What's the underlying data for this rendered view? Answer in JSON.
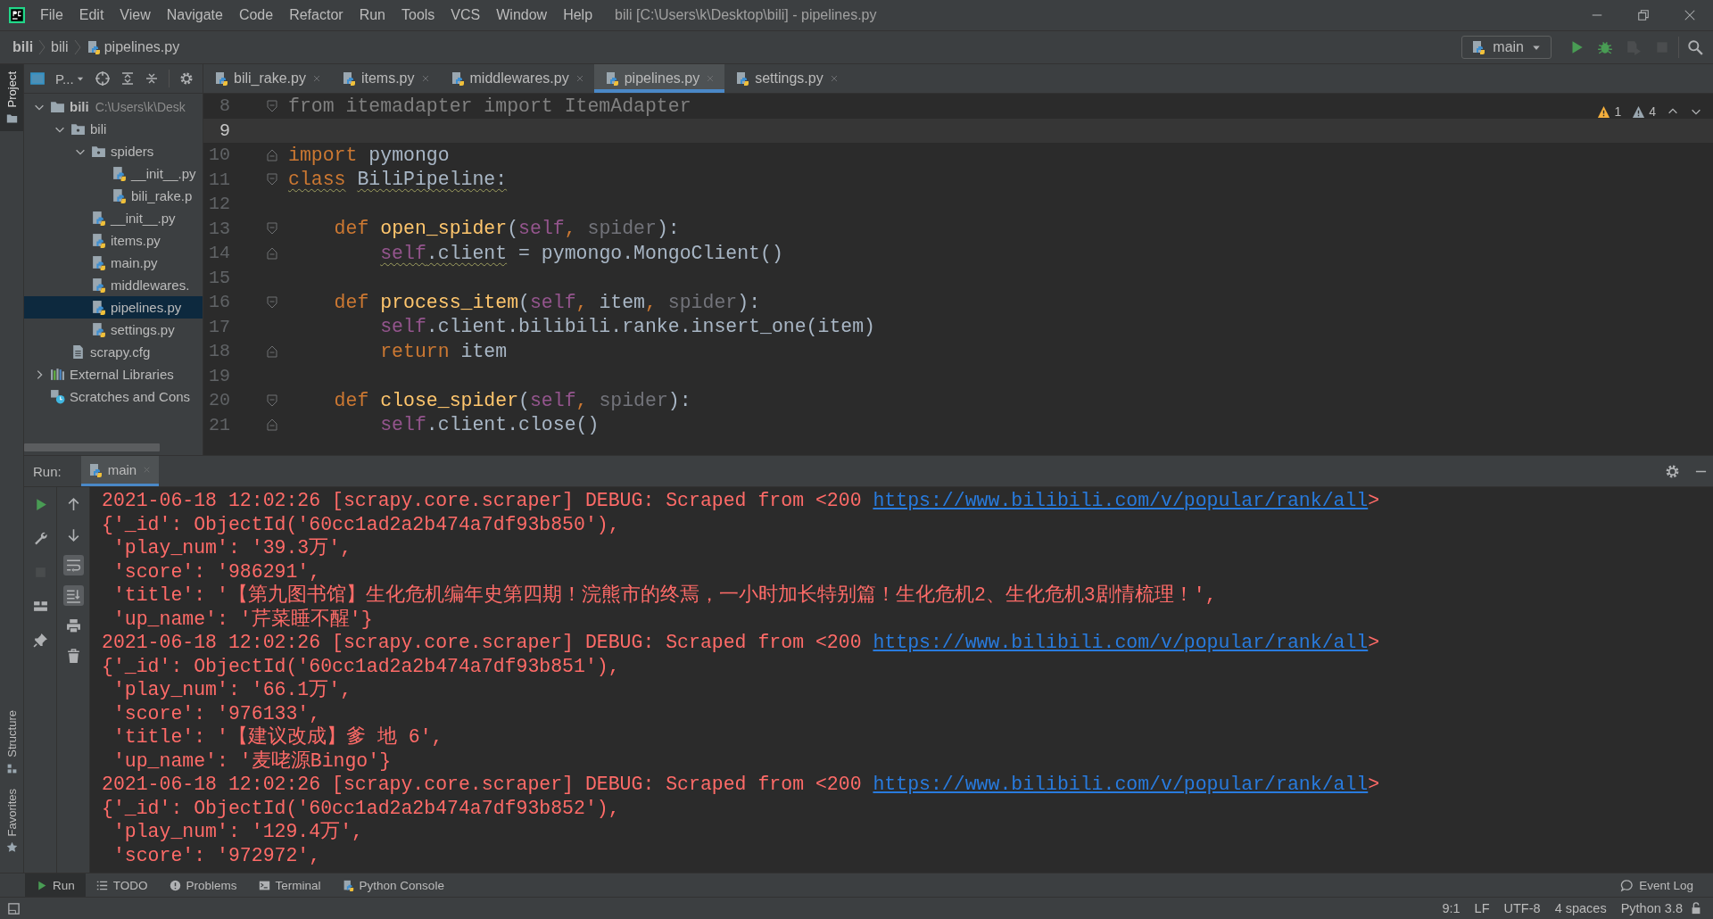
{
  "window": {
    "title": "bili [C:\\Users\\k\\Desktop\\bili] - pipelines.py"
  },
  "menu": [
    "File",
    "Edit",
    "View",
    "Navigate",
    "Code",
    "Refactor",
    "Run",
    "Tools",
    "VCS",
    "Window",
    "Help"
  ],
  "breadcrumbs": [
    "bili",
    "bili",
    "pipelines.py"
  ],
  "run_config": {
    "label": "main"
  },
  "actions": [
    {
      "kind": "run",
      "disabled": false
    },
    {
      "kind": "debug",
      "disabled": false
    },
    {
      "kind": "coverage",
      "disabled": true
    },
    {
      "kind": "stop",
      "disabled": true
    },
    {
      "kind": "search",
      "disabled": false
    }
  ],
  "side_stripe": [
    {
      "label": "Project",
      "kind": "project",
      "selected": true
    },
    {
      "label": "Structure",
      "kind": "structure",
      "selected": false
    },
    {
      "label": "Favorites",
      "kind": "favorites",
      "selected": false
    }
  ],
  "project": {
    "title": "P...",
    "tree": [
      {
        "label": "bili",
        "hint": "C:\\Users\\k\\Desk",
        "kind": "root",
        "expanded": true,
        "selected": false,
        "children": [
          {
            "label": "bili",
            "kind": "package",
            "expanded": true,
            "selected": false,
            "children": [
              {
                "label": "spiders",
                "kind": "package",
                "expanded": true,
                "selected": false,
                "children": [
                  {
                    "label": "__init__.py",
                    "kind": "python",
                    "selected": false
                  },
                  {
                    "label": "bili_rake.p",
                    "kind": "python",
                    "selected": false
                  }
                ]
              },
              {
                "label": "__init__.py",
                "kind": "python",
                "selected": false
              },
              {
                "label": "items.py",
                "kind": "python",
                "selected": false
              },
              {
                "label": "main.py",
                "kind": "python",
                "selected": false
              },
              {
                "label": "middlewares.",
                "kind": "python",
                "selected": false
              },
              {
                "label": "pipelines.py",
                "kind": "python",
                "selected": true
              },
              {
                "label": "settings.py",
                "kind": "python",
                "selected": false
              }
            ]
          },
          {
            "label": "scrapy.cfg",
            "kind": "config",
            "selected": false
          }
        ]
      },
      {
        "label": "External Libraries",
        "kind": "libraries",
        "expanded": false,
        "selected": false
      },
      {
        "label": "Scratches and Cons",
        "kind": "scratches",
        "selected": false
      }
    ]
  },
  "editor_tabs": [
    {
      "label": "bili_rake.py",
      "selected": false
    },
    {
      "label": "items.py",
      "selected": false
    },
    {
      "label": "middlewares.py",
      "selected": false
    },
    {
      "label": "pipelines.py",
      "selected": true
    },
    {
      "label": "settings.py",
      "selected": false
    }
  ],
  "editor": {
    "inspections": [
      {
        "kind": "warning",
        "count": "1"
      },
      {
        "kind": "weak_warning",
        "count": "4"
      }
    ],
    "lines": [
      {
        "number": "8",
        "current": false,
        "fold": {
          "kind": "start"
        },
        "tokens": [
          {
            "text": "from itemadapter import ItemAdapter",
            "kind": "unused"
          }
        ]
      },
      {
        "number": "9",
        "current": true
      },
      {
        "number": "10",
        "current": false,
        "fold": {
          "kind": "end"
        },
        "tokens": [
          {
            "text": "import",
            "kind": "keyword"
          },
          {
            "text": " pymongo",
            "kind": "plain"
          }
        ]
      },
      {
        "number": "11",
        "current": false,
        "fold": {
          "kind": "start"
        },
        "tokens": [
          {
            "text": "class",
            "kind": "keyword",
            "warn": true
          },
          {
            "text": " BiliPipeline:",
            "kind": "plain",
            "warn": true
          }
        ]
      },
      {
        "number": "12",
        "current": false
      },
      {
        "number": "13",
        "current": false,
        "fold": {
          "kind": "start"
        },
        "tokens": [
          {
            "text": "    def",
            "kind": "keyword"
          },
          {
            "text": " open_spider",
            "kind": "function"
          },
          {
            "text": "(",
            "kind": "plain"
          },
          {
            "text": "self",
            "kind": "self"
          },
          {
            "text": ",",
            "kind": "punct"
          },
          {
            "text": " spider",
            "kind": "param"
          },
          {
            "text": "):",
            "kind": "plain"
          }
        ]
      },
      {
        "number": "14",
        "current": false,
        "fold": {
          "kind": "end"
        },
        "tokens": [
          {
            "text": "        self",
            "kind": "self",
            "warn": true
          },
          {
            "text": ".client",
            "kind": "plain",
            "warn": true
          },
          {
            "text": " = pymongo.MongoClient()",
            "kind": "plain"
          }
        ]
      },
      {
        "number": "15",
        "current": false
      },
      {
        "number": "16",
        "current": false,
        "fold": {
          "kind": "start"
        },
        "tokens": [
          {
            "text": "    def",
            "kind": "keyword"
          },
          {
            "text": " process_item",
            "kind": "function"
          },
          {
            "text": "(",
            "kind": "plain"
          },
          {
            "text": "self",
            "kind": "self"
          },
          {
            "text": ",",
            "kind": "punct"
          },
          {
            "text": " item",
            "kind": "plain"
          },
          {
            "text": ",",
            "kind": "punct"
          },
          {
            "text": " spider",
            "kind": "param"
          },
          {
            "text": "):",
            "kind": "plain"
          }
        ]
      },
      {
        "number": "17",
        "current": false,
        "tokens": [
          {
            "text": "        self",
            "kind": "self"
          },
          {
            "text": ".client.bilibili.ranke.insert_one(item)",
            "kind": "plain"
          }
        ]
      },
      {
        "number": "18",
        "current": false,
        "fold": {
          "kind": "end"
        },
        "tokens": [
          {
            "text": "        return",
            "kind": "keyword"
          },
          {
            "text": " item",
            "kind": "plain"
          }
        ]
      },
      {
        "number": "19",
        "current": false
      },
      {
        "number": "20",
        "current": false,
        "fold": {
          "kind": "start"
        },
        "tokens": [
          {
            "text": "    def",
            "kind": "keyword"
          },
          {
            "text": " close_spider",
            "kind": "function"
          },
          {
            "text": "(",
            "kind": "plain"
          },
          {
            "text": "self",
            "kind": "self"
          },
          {
            "text": ",",
            "kind": "punct"
          },
          {
            "text": " spider",
            "kind": "param"
          },
          {
            "text": "):",
            "kind": "plain"
          }
        ]
      },
      {
        "number": "21",
        "current": false,
        "fold": {
          "kind": "end"
        },
        "tokens": [
          {
            "text": "        self",
            "kind": "self"
          },
          {
            "text": ".client.close()",
            "kind": "plain"
          }
        ]
      }
    ]
  },
  "run": {
    "label": "Run:",
    "tab": "main",
    "primary_tools": [
      {
        "kind": "rerun",
        "disabled": false
      },
      {
        "kind": "wrench",
        "disabled": false
      },
      {
        "kind": "stop",
        "disabled": true
      },
      {
        "kind": "layout",
        "disabled": false
      },
      {
        "kind": "pin",
        "disabled": false
      }
    ],
    "secondary_tools": [
      {
        "kind": "up",
        "on": false
      },
      {
        "kind": "down",
        "on": false
      },
      {
        "kind": "wrap",
        "on": true
      },
      {
        "kind": "scroll_end",
        "on": true
      },
      {
        "kind": "print",
        "on": false
      },
      {
        "kind": "trash",
        "on": false
      }
    ],
    "console": [
      {
        "kind": "log",
        "text": "2021-06-18 12:02:26 [scrapy.core.scraper] DEBUG: Scraped from <200",
        "link": "https://www.bilibili.com/v/popular/rank/all",
        "tail": ">"
      },
      {
        "kind": "text",
        "text": "{'_id': ObjectId('60cc1ad2a2b474a7df93b850'),"
      },
      {
        "kind": "text",
        "text": " 'play_num': '39.3万',"
      },
      {
        "kind": "text",
        "text": " 'score': '986291',"
      },
      {
        "kind": "text",
        "text": " 'title': '【第九图书馆】生化危机编年史第四期！浣熊市的终焉，一小时加长特别篇！生化危机2、生化危机3剧情梳理！',"
      },
      {
        "kind": "text",
        "text": " 'up_name': '芹菜睡不醒'}"
      },
      {
        "kind": "log",
        "text": "2021-06-18 12:02:26 [scrapy.core.scraper] DEBUG: Scraped from <200",
        "link": "https://www.bilibili.com/v/popular/rank/all",
        "tail": ">"
      },
      {
        "kind": "text",
        "text": "{'_id': ObjectId('60cc1ad2a2b474a7df93b851'),"
      },
      {
        "kind": "text",
        "text": " 'play_num': '66.1万',"
      },
      {
        "kind": "text",
        "text": " 'score': '976133',"
      },
      {
        "kind": "text",
        "text": " 'title': '【建议改成】爹 地 6',"
      },
      {
        "kind": "text",
        "text": " 'up_name': '麦咾源Bingo'}"
      },
      {
        "kind": "log",
        "text": "2021-06-18 12:02:26 [scrapy.core.scraper] DEBUG: Scraped from <200",
        "link": "https://www.bilibili.com/v/popular/rank/all",
        "tail": ">"
      },
      {
        "kind": "text",
        "text": "{'_id': ObjectId('60cc1ad2a2b474a7df93b852'),"
      },
      {
        "kind": "text",
        "text": " 'play_num': '129.4万',"
      },
      {
        "kind": "text",
        "text": " 'score': '972972',"
      }
    ]
  },
  "tool_windows": [
    {
      "label": "Run",
      "kind": "run",
      "selected": true
    },
    {
      "label": "TODO",
      "kind": "todo",
      "selected": false
    },
    {
      "label": "Problems",
      "kind": "problems",
      "selected": false
    },
    {
      "label": "Terminal",
      "kind": "terminal",
      "selected": false
    },
    {
      "label": "Python Console",
      "kind": "python",
      "selected": false
    }
  ],
  "event_log": {
    "label": "Event Log"
  },
  "status_bar": [
    "9:1",
    "LF",
    "UTF-8",
    "4 spaces",
    "Python 3.8"
  ]
}
